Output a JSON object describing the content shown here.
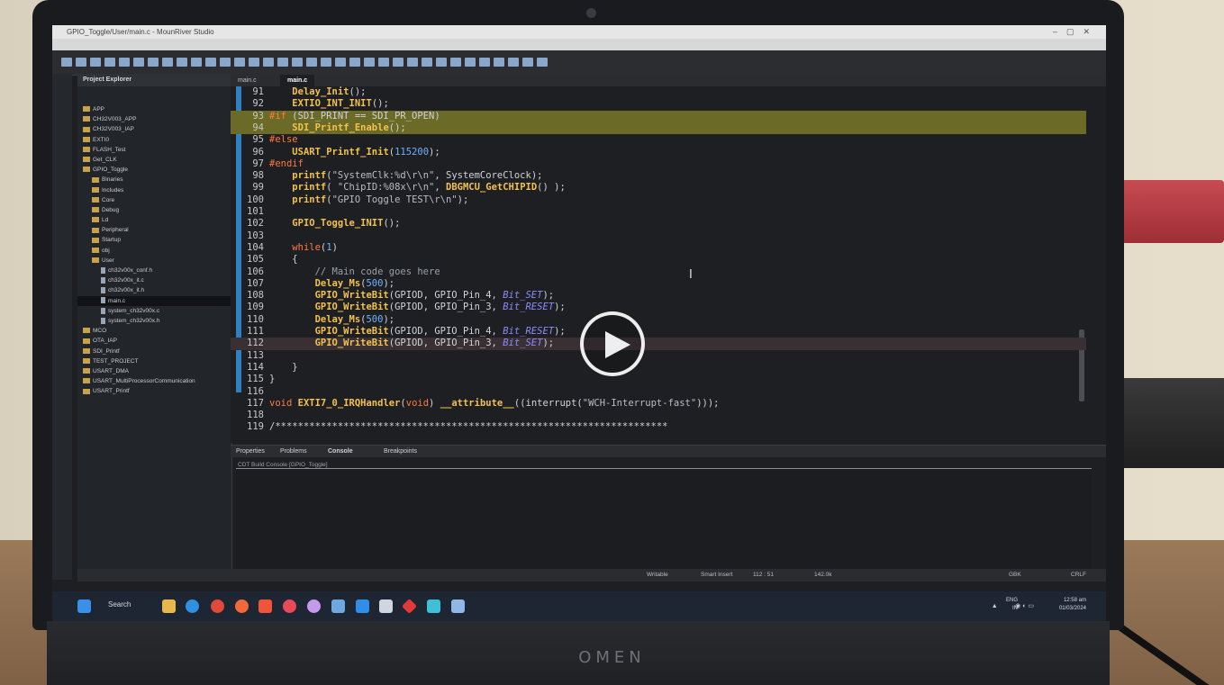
{
  "window": {
    "title": "GPIO_Toggle/User/main.c - MounRiver Studio"
  },
  "explorer": {
    "title": "Project Explorer",
    "items": [
      {
        "label": "APP",
        "indent": 0,
        "type": "folder"
      },
      {
        "label": "CH32V003_APP",
        "indent": 0,
        "type": "folder"
      },
      {
        "label": "CH32V003_IAP",
        "indent": 0,
        "type": "folder"
      },
      {
        "label": "EXTI0",
        "indent": 0,
        "type": "folder"
      },
      {
        "label": "FLASH_Test",
        "indent": 0,
        "type": "folder"
      },
      {
        "label": "Get_CLK",
        "indent": 0,
        "type": "folder"
      },
      {
        "label": "GPIO_Toggle",
        "indent": 0,
        "type": "folder"
      },
      {
        "label": "Binaries",
        "indent": 1,
        "type": "folder"
      },
      {
        "label": "Includes",
        "indent": 1,
        "type": "folder"
      },
      {
        "label": "Core",
        "indent": 1,
        "type": "folder"
      },
      {
        "label": "Debug",
        "indent": 1,
        "type": "folder"
      },
      {
        "label": "Ld",
        "indent": 1,
        "type": "folder"
      },
      {
        "label": "Peripheral",
        "indent": 1,
        "type": "folder"
      },
      {
        "label": "Startup",
        "indent": 1,
        "type": "folder"
      },
      {
        "label": "obj",
        "indent": 1,
        "type": "folder"
      },
      {
        "label": "User",
        "indent": 1,
        "type": "folder"
      },
      {
        "label": "ch32v00x_conf.h",
        "indent": 2,
        "type": "file"
      },
      {
        "label": "ch32v00x_it.c",
        "indent": 2,
        "type": "file"
      },
      {
        "label": "ch32v00x_it.h",
        "indent": 2,
        "type": "file"
      },
      {
        "label": "main.c",
        "indent": 2,
        "type": "file",
        "selected": true
      },
      {
        "label": "system_ch32v00x.c",
        "indent": 2,
        "type": "file"
      },
      {
        "label": "system_ch32v00x.h",
        "indent": 2,
        "type": "file"
      },
      {
        "label": "MCO",
        "indent": 0,
        "type": "folder"
      },
      {
        "label": "OTA_IAP",
        "indent": 0,
        "type": "folder"
      },
      {
        "label": "SDI_Printf",
        "indent": 0,
        "type": "folder"
      },
      {
        "label": "TEST_PROJECT",
        "indent": 0,
        "type": "folder"
      },
      {
        "label": "USART_DMA",
        "indent": 0,
        "type": "folder"
      },
      {
        "label": "USART_MultiProcessorCommunication",
        "indent": 0,
        "type": "folder"
      },
      {
        "label": "USART_Printf",
        "indent": 0,
        "type": "folder"
      }
    ]
  },
  "editor": {
    "tabs": [
      "main.c",
      "main.c"
    ],
    "lines": [
      {
        "n": "91",
        "text": "    Delay_Init();",
        "style": "normal"
      },
      {
        "n": "92",
        "text": "    EXTIO_INT_INIT();",
        "style": "normal"
      },
      {
        "n": "93",
        "text": "#if (SDI_PRINT == SDI_PR_OPEN)",
        "style": "hl"
      },
      {
        "n": "94",
        "text": "    SDI_Printf_Enable();",
        "style": "hl"
      },
      {
        "n": "95",
        "text": "#else",
        "style": "normal"
      },
      {
        "n": "96",
        "text": "    USART_Printf_Init(115200);",
        "style": "normal"
      },
      {
        "n": "97",
        "text": "#endif",
        "style": "normal"
      },
      {
        "n": "98",
        "text": "    printf(\"SystemClk:%d\\r\\n\", SystemCoreClock);",
        "style": "normal"
      },
      {
        "n": "99",
        "text": "    printf( \"ChipID:%08x\\r\\n\", DBGMCU_GetCHIPID() );",
        "style": "normal"
      },
      {
        "n": "100",
        "text": "    printf(\"GPIO Toggle TEST\\r\\n\");",
        "style": "normal"
      },
      {
        "n": "101",
        "text": "",
        "style": "normal"
      },
      {
        "n": "102",
        "text": "    GPIO_Toggle_INIT();",
        "style": "normal"
      },
      {
        "n": "103",
        "text": "",
        "style": "normal"
      },
      {
        "n": "104",
        "text": "    while(1)",
        "style": "normal"
      },
      {
        "n": "105",
        "text": "    {",
        "style": "normal"
      },
      {
        "n": "106",
        "text": "        // Main code goes here",
        "style": "normal"
      },
      {
        "n": "107",
        "text": "        Delay_Ms(500);",
        "style": "normal"
      },
      {
        "n": "108",
        "text": "        GPIO_WriteBit(GPIOD, GPIO_Pin_4, Bit_SET);",
        "style": "normal"
      },
      {
        "n": "109",
        "text": "        GPIO_WriteBit(GPIOD, GPIO_Pin_3, Bit_RESET);",
        "style": "normal"
      },
      {
        "n": "110",
        "text": "        Delay_Ms(500);",
        "style": "normal"
      },
      {
        "n": "111",
        "text": "        GPIO_WriteBit(GPIOD, GPIO_Pin_4, Bit_RESET);",
        "style": "normal"
      },
      {
        "n": "112",
        "text": "        GPIO_WriteBit(GPIOD, GPIO_Pin_3, Bit_SET);",
        "style": "hl2"
      },
      {
        "n": "113",
        "text": "",
        "style": "normal"
      },
      {
        "n": "114",
        "text": "    }",
        "style": "normal"
      },
      {
        "n": "115",
        "text": "}",
        "style": "normal"
      },
      {
        "n": "116",
        "text": "",
        "style": "normal"
      },
      {
        "n": "117",
        "text": "void EXTI7_0_IRQHandler(void) __attribute__((interrupt(\"WCH-Interrupt-fast\")));",
        "style": "normal"
      },
      {
        "n": "118",
        "text": "",
        "style": "normal"
      },
      {
        "n": "119",
        "text": "/*********************************************************************",
        "style": "normal"
      }
    ]
  },
  "console": {
    "tabs": [
      "Properties",
      "Problems",
      "Console",
      "Breakpoints"
    ],
    "label": "CDT Build Console [GPIO_Toggle]"
  },
  "statusbar": {
    "writable": "Writable",
    "insert_mode": "Smart Insert",
    "position": "112 : 51",
    "memory": "142.0k",
    "encoding": "GBK",
    "line_ending": "CRLF"
  },
  "taskbar": {
    "search": "Search",
    "lang": "ENG",
    "region": "IN",
    "time": "12:58 am",
    "date": "01/03/2024"
  },
  "brand": "OMEN",
  "colors": {
    "keyword": "#ff7a3d",
    "function": "#f2c14e",
    "number": "#6fb0ff",
    "string": "#b8bcc4",
    "comment": "#9aa0a8",
    "constant": "#8c8cff",
    "highlight": "#6b6a26",
    "ruler": "#2f7fc1"
  }
}
